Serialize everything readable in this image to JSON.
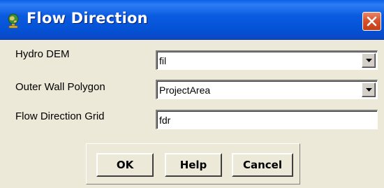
{
  "window": {
    "title": "Flow Direction",
    "icons": {
      "app": "globe-gear-icon",
      "close": "close-icon"
    },
    "colors": {
      "titlebar": "#0452d6",
      "close_button": "#d8522d",
      "dialog_bg": "#ece9d8"
    }
  },
  "form": {
    "hydro_dem": {
      "label": "Hydro DEM",
      "value": "fil"
    },
    "outer_wall": {
      "label": "Outer Wall Polygon",
      "value": "ProjectArea"
    },
    "flow_dir_grid": {
      "label": "Flow Direction Grid",
      "value": "fdr"
    }
  },
  "buttons": {
    "ok": "OK",
    "help": "Help",
    "cancel": "Cancel"
  }
}
